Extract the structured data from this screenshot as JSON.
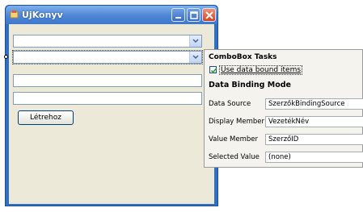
{
  "window": {
    "title": "UjKonyv"
  },
  "form": {
    "create_button": "Létrehoz"
  },
  "tasks_panel": {
    "header": "ComboBox Tasks",
    "use_data_bound_label": "Use data bound items",
    "use_data_bound_checked": true,
    "section_title": "Data Binding Mode",
    "rows": [
      {
        "label": "Data Source",
        "value": "SzerzőkBindingSource"
      },
      {
        "label": "Display Member",
        "value": "VezetékNév"
      },
      {
        "label": "Value Member",
        "value": "SzerzőID"
      },
      {
        "label": "Selected Value",
        "value": "(none)"
      }
    ]
  },
  "colors": {
    "titlebar": "#4d86d6",
    "client": "#ece9d8",
    "close": "#d4411e"
  }
}
